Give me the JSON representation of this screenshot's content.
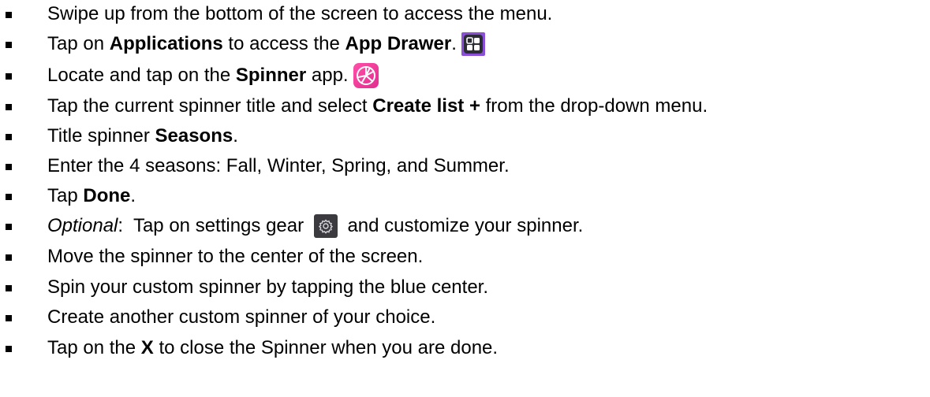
{
  "steps": [
    {
      "segments": [
        {
          "t": "Swipe up from the bottom of the screen to access the menu."
        }
      ]
    },
    {
      "segments": [
        {
          "t": "Tap on "
        },
        {
          "t": "Applications",
          "b": true
        },
        {
          "t": " to access the "
        },
        {
          "t": "App Drawer",
          "b": true
        },
        {
          "t": "."
        }
      ],
      "icon": "app-drawer-icon"
    },
    {
      "segments": [
        {
          "t": "Locate and tap on the "
        },
        {
          "t": "Spinner",
          "b": true
        },
        {
          "t": " app."
        }
      ],
      "icon": "spinner-app-icon"
    },
    {
      "segments": [
        {
          "t": "Tap the current spinner title and select "
        },
        {
          "t": "Create list +",
          "b": true
        },
        {
          "t": " from the drop-down menu."
        }
      ]
    },
    {
      "segments": [
        {
          "t": "Title spinner "
        },
        {
          "t": "Seasons",
          "b": true
        },
        {
          "t": "."
        }
      ]
    },
    {
      "segments": [
        {
          "t": "Enter the 4 seasons: Fall, Winter, Spring, and Summer."
        }
      ]
    },
    {
      "segments": [
        {
          "t": "Tap "
        },
        {
          "t": "Done",
          "b": true
        },
        {
          "t": "."
        }
      ]
    },
    {
      "segments": [
        {
          "t": "Optional",
          "i": true
        },
        {
          "t": ":  Tap on settings gear "
        }
      ],
      "icon": "settings-gear-icon",
      "after": [
        {
          "t": " and customize your spinner."
        }
      ]
    },
    {
      "segments": [
        {
          "t": "Move the spinner to the center of the screen."
        }
      ]
    },
    {
      "segments": [
        {
          "t": "Spin your custom spinner by tapping the blue center."
        }
      ]
    },
    {
      "segments": [
        {
          "t": "Create another custom spinner of your choice."
        }
      ]
    },
    {
      "segments": [
        {
          "t": "Tap on the "
        },
        {
          "t": "X",
          "b": true
        },
        {
          "t": " to close the Spinner when you are done."
        }
      ]
    }
  ],
  "colors": {
    "text": "#000000",
    "app_drawer_frame": "#8a4fd6",
    "app_drawer_tile": "#2c2c34",
    "spinner_pink": "#e22d8f",
    "gear_bg": "#3a3a3f"
  }
}
